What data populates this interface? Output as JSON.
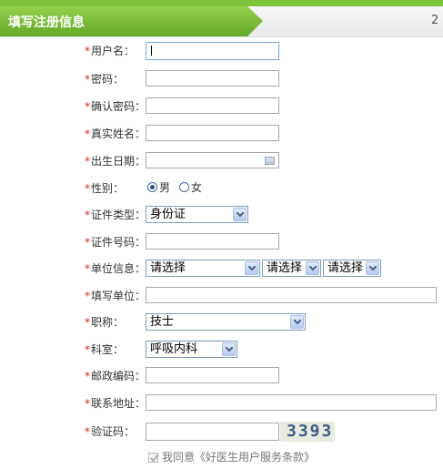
{
  "header": {
    "title": "填写注册信息",
    "next_step": "2"
  },
  "form": {
    "username": {
      "label": "用户名：",
      "value": ""
    },
    "password": {
      "label": "密码：",
      "value": ""
    },
    "confirm_password": {
      "label": "确认密码：",
      "value": ""
    },
    "real_name": {
      "label": "真实姓名：",
      "value": ""
    },
    "birth_date": {
      "label": "出生日期：",
      "value": ""
    },
    "gender": {
      "label": "性别：",
      "options": [
        "男",
        "女"
      ],
      "selected": "男"
    },
    "id_type": {
      "label": "证件类型：",
      "value": "身份证"
    },
    "id_number": {
      "label": "证件号码：",
      "value": ""
    },
    "unit_info": {
      "label": "单位信息：",
      "select1": "请选择",
      "select2": "请选择",
      "select3": "请选择"
    },
    "fill_unit": {
      "label": "填写单位：",
      "value": ""
    },
    "job_title": {
      "label": "职称：",
      "value": "技士"
    },
    "department": {
      "label": "科室：",
      "value": "呼吸内科"
    },
    "postal_code": {
      "label": "邮政编码：",
      "value": ""
    },
    "address": {
      "label": "联系地址：",
      "value": ""
    },
    "captcha": {
      "label": "验证码：",
      "value": "",
      "image_text": "3393"
    },
    "agreement": {
      "text": "我同意《好医生用户服务条款》",
      "checked": true
    }
  },
  "required_mark": "*",
  "colors": {
    "header_green": "#7fc33b",
    "required": "#e02020"
  }
}
